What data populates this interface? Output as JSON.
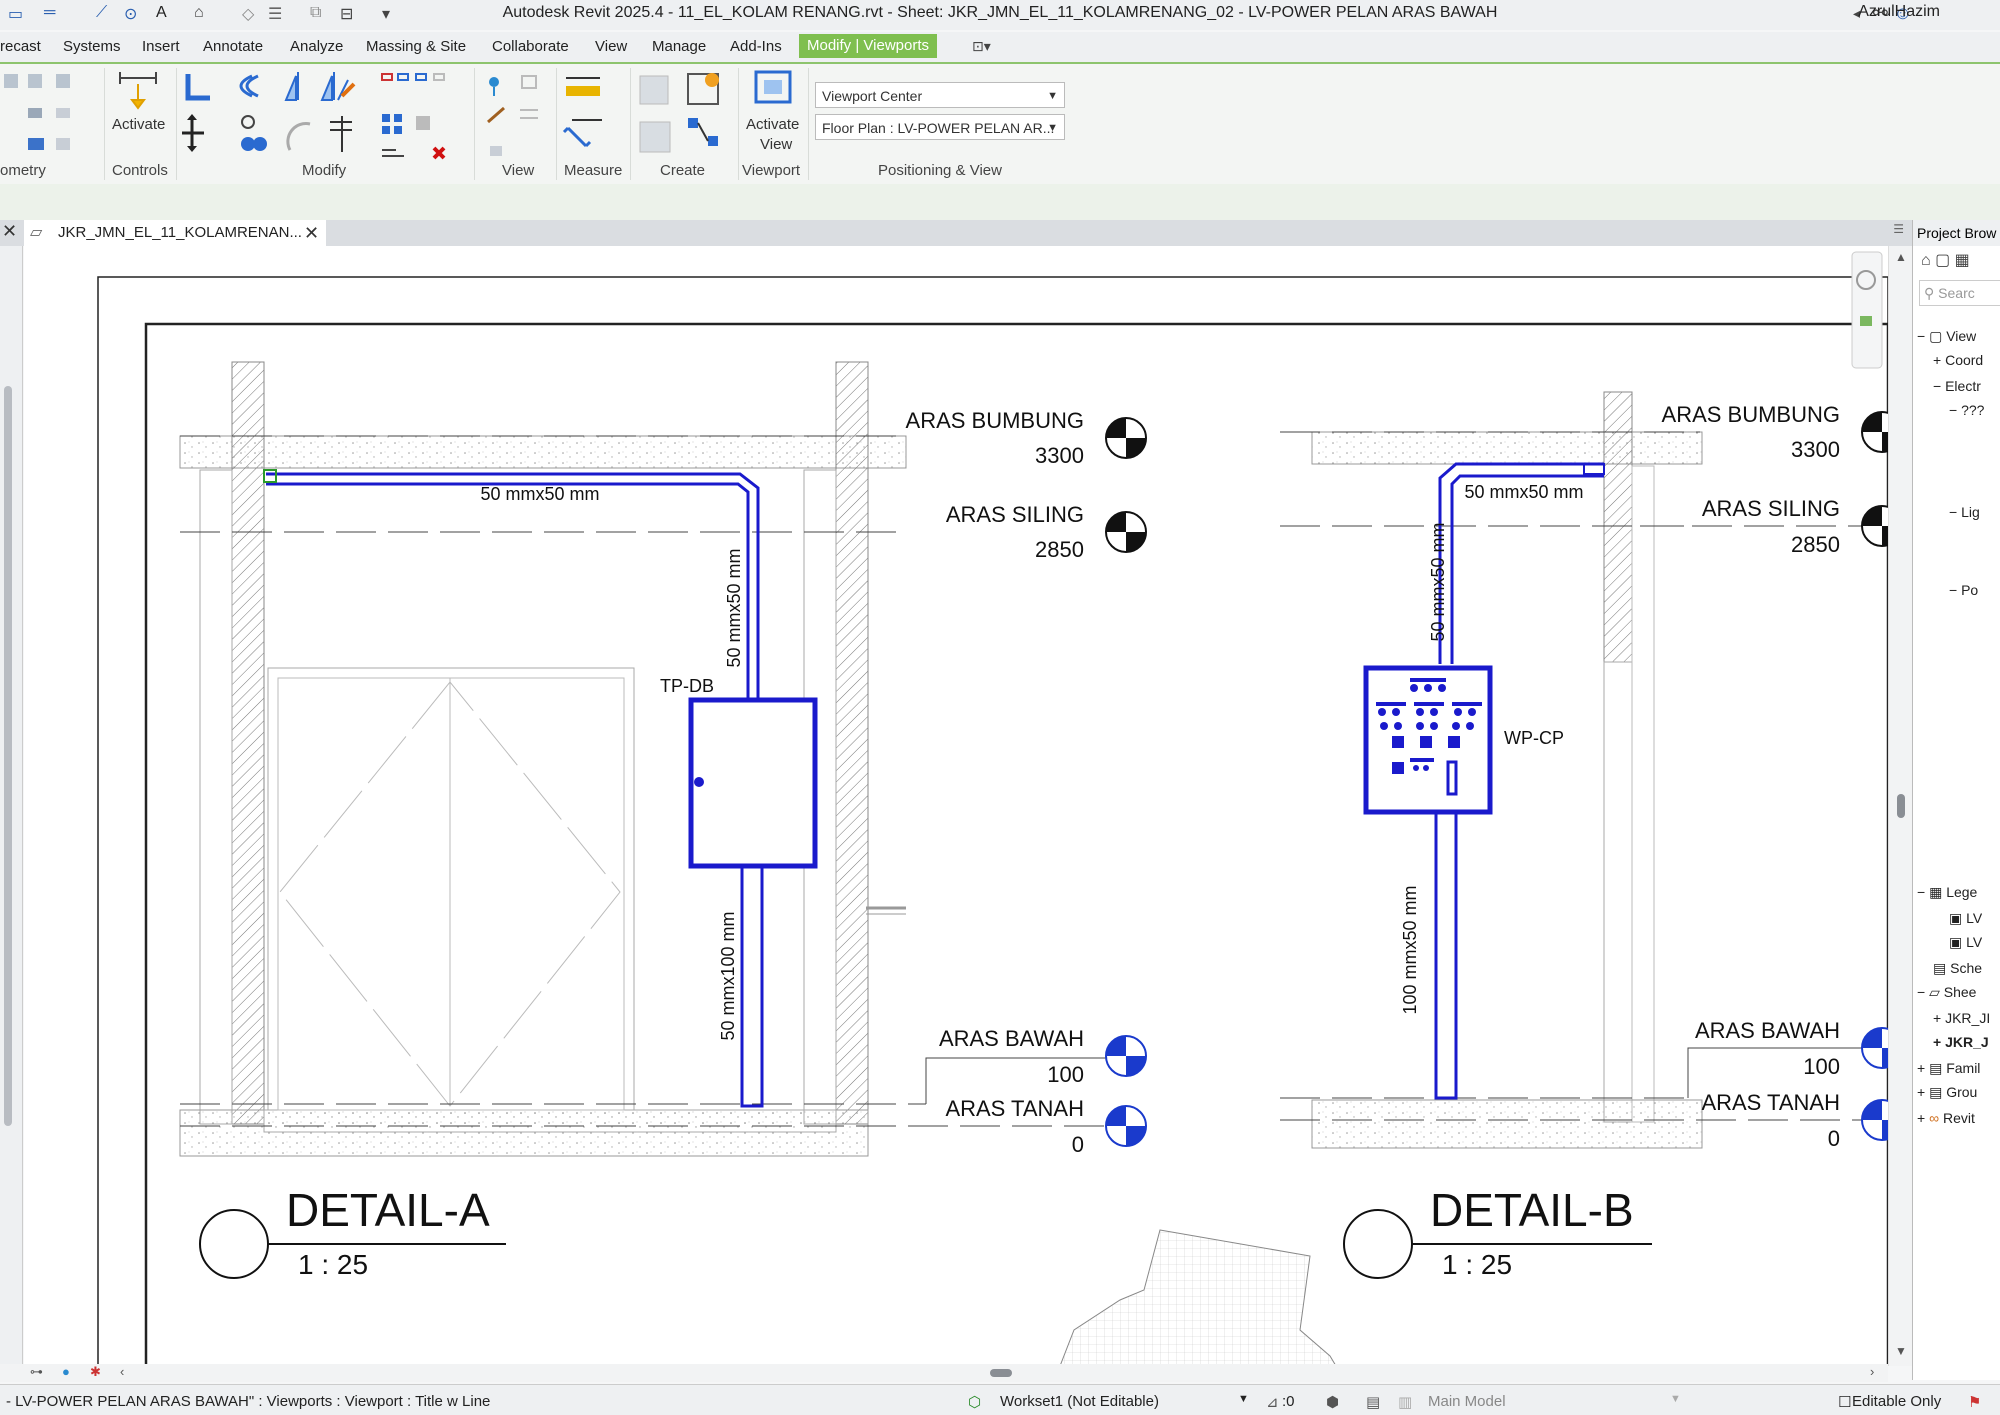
{
  "window": {
    "title": "Autodesk Revit 2025.4 - 11_EL_KOLAM RENANG.rvt - Sheet: JKR_JMN_EL_11_KOLAMRENANG_02 - LV-POWER PELAN ARAS BAWAH",
    "user": "AzrulHazim"
  },
  "menu": {
    "items": [
      "recast",
      "Systems",
      "Insert",
      "Annotate",
      "Analyze",
      "Massing & Site",
      "Collaborate",
      "View",
      "Manage",
      "Add-Ins"
    ],
    "active": "Modify | Viewports"
  },
  "ribbon": {
    "panels": [
      "ometry",
      "Controls",
      "Modify",
      "View",
      "Measure",
      "Create",
      "Viewport",
      "Positioning & View"
    ],
    "activate_label": "Activate",
    "activate_view_line1": "Activate",
    "activate_view_line2": "View",
    "viewport_position": "Viewport Center",
    "viewport_view": "Floor Plan : LV-POWER PELAN AR..."
  },
  "tab": {
    "label": "JKR_JMN_EL_11_KOLAMRENAN..."
  },
  "browser": {
    "title": "Project Brow",
    "search_placeholder": "Searc",
    "items": [
      "View",
      "Coord",
      "Electr",
      "???",
      "Lig",
      "Po",
      "Lege",
      "LV",
      "LV",
      "Sche",
      "Shee",
      "JKR_JI",
      "JKR_J",
      "Famil",
      "Grou",
      "Revit"
    ]
  },
  "drawing": {
    "detail_a": {
      "title": "DETAIL-A",
      "scale": "1 : 25",
      "levels": [
        {
          "name": "ARAS BUMBUNG",
          "value": "3300"
        },
        {
          "name": "ARAS SILING",
          "value": "2850"
        },
        {
          "name": "ARAS BAWAH",
          "value": "100"
        },
        {
          "name": "ARAS TANAH",
          "value": "0"
        }
      ],
      "conduit_horizontal": "50 mmx50 mm",
      "conduit_vertical_top": "50 mmx50 mm",
      "conduit_vertical_bottom": "50 mmx100 mm",
      "panel_tag": "TP-DB"
    },
    "detail_b": {
      "title": "DETAIL-B",
      "scale": "1 : 25",
      "levels": [
        {
          "name": "ARAS BUMBUNG",
          "value": "3300"
        },
        {
          "name": "ARAS SILING",
          "value": "2850"
        },
        {
          "name": "ARAS BAWAH",
          "value": "100"
        },
        {
          "name": "ARAS TANAH",
          "value": "0"
        }
      ],
      "conduit_horizontal": "50 mmx50 mm",
      "conduit_vertical_top": "50 mmx50 mm",
      "conduit_vertical_bottom": "100 mmx50 mm",
      "panel_tag": "WP-CP"
    }
  },
  "status": {
    "selection": "- LV-POWER PELAN ARAS BAWAH\" : Viewports : Viewport : Title w Line",
    "workset": "Workset1 (Not Editable)",
    "count": ":0",
    "model": "Main Model",
    "editable_only": "Editable Only"
  },
  "colors": {
    "accent_green": "#7fbf4f",
    "conduit_blue": "#1a1acc",
    "ribbon_bg": "#f3f5f3"
  }
}
